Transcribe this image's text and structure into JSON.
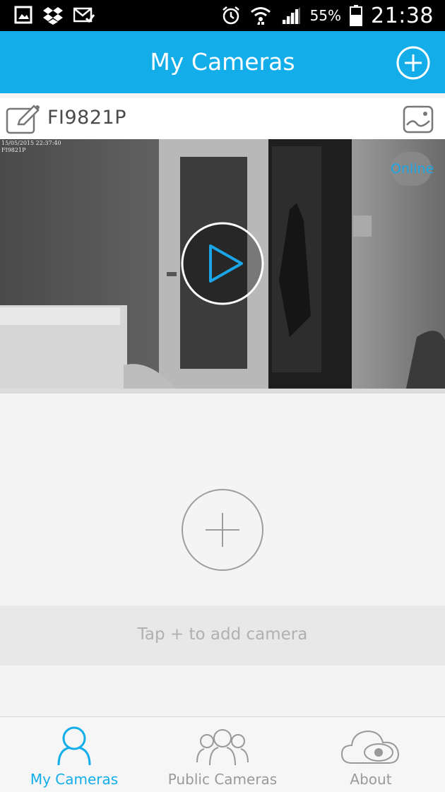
{
  "status_bar": {
    "battery_percent": "55%",
    "time": "21:38",
    "icons": [
      "gallery-icon",
      "dropbox-icon",
      "mail-check-icon",
      "alarm-icon",
      "wifi-icon",
      "signal-icon",
      "battery-icon"
    ]
  },
  "header": {
    "title": "My Cameras",
    "add_icon": "plus-circle-icon"
  },
  "camera": {
    "name": "FI9821P",
    "osd_date": "15/05/2015 22:37:40",
    "osd_name": "FI9821P",
    "status": "Online",
    "edit_icon": "edit-icon",
    "gallery_icon": "picture-icon",
    "play_icon": "play-icon"
  },
  "empty_state": {
    "hint": "Tap + to add camera",
    "add_icon": "plus-circle-icon"
  },
  "bottom_nav": {
    "items": [
      {
        "label": "My Cameras",
        "icon": "user-icon",
        "active": true
      },
      {
        "label": "Public Cameras",
        "icon": "group-icon",
        "active": false
      },
      {
        "label": "About",
        "icon": "cloud-eye-icon",
        "active": false
      }
    ]
  },
  "colors": {
    "accent": "#13aeea",
    "status_bar": "#000000",
    "online": "#1aa6e6"
  }
}
